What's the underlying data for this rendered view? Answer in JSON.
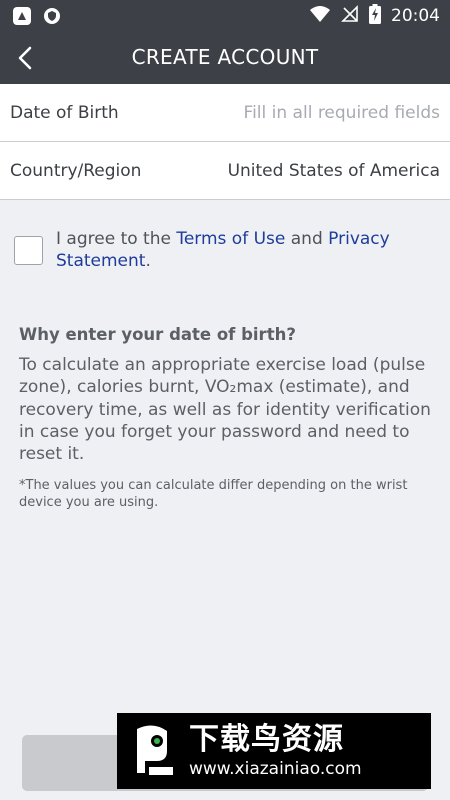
{
  "status_bar": {
    "time": "20:04"
  },
  "app_bar": {
    "title": "CREATE ACCOUNT"
  },
  "form": {
    "rows": [
      {
        "label": "Date of Birth",
        "value": "Fill in all required fields"
      },
      {
        "label": "Country/Region",
        "value": "United States of America"
      }
    ]
  },
  "agreement": {
    "prefix": "I agree to the ",
    "terms_link": "Terms of Use",
    "middle": " and ",
    "privacy_link": "Privacy Statement",
    "suffix": "."
  },
  "info": {
    "title": "Why enter your date of birth?",
    "body": "To calculate an appropriate exercise load (pulse zone), calories burnt, VO₂max (estimate), and recovery time, as well as for identity verification in case you forget your password and need to reset it.",
    "note": "*The values you can calculate differ depending on the wrist device you are using."
  },
  "watermark": {
    "cn_text": "下载鸟资源",
    "url": "www.xiazainiao.com"
  }
}
